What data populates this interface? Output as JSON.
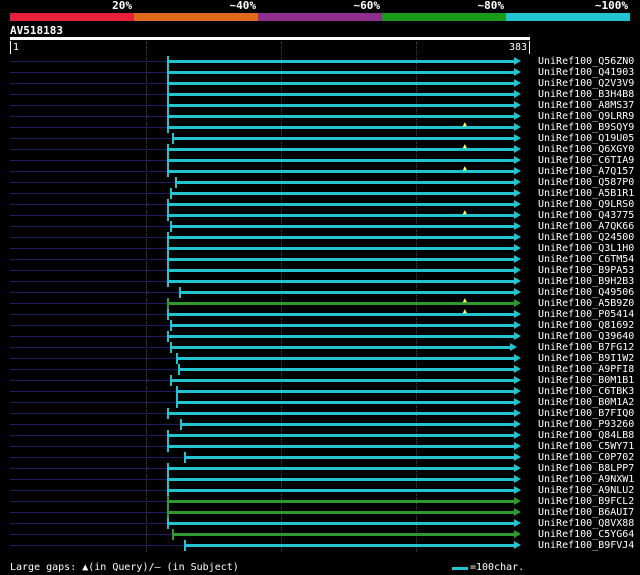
{
  "legend": {
    "items": [
      {
        "label": "20%",
        "color": "#e8203a"
      },
      {
        "label": "~40%",
        "color": "#e06a1a"
      },
      {
        "label": "~60%",
        "color": "#8e2f8e"
      },
      {
        "label": "~80%",
        "color": "#1a9a1a"
      },
      {
        "label": "~100%",
        "color": "#22c4cf"
      }
    ]
  },
  "query": {
    "title": "AV518183",
    "start": "1",
    "end": "383"
  },
  "colors": {
    "cyan": "#22c4cf",
    "green": "#2e9a2e",
    "gap": "#1a1f66",
    "caret": "#ffff66"
  },
  "hits": [
    {
      "label": "UniRef100_Q56ZN0",
      "start": 118,
      "end": 383,
      "color": "cyan",
      "caret": false
    },
    {
      "label": "UniRef100_Q41903",
      "start": 118,
      "end": 383,
      "color": "cyan",
      "caret": false
    },
    {
      "label": "UniRef100_Q2V3V9",
      "start": 118,
      "end": 383,
      "color": "cyan",
      "caret": false
    },
    {
      "label": "UniRef100_B3H4B8",
      "start": 118,
      "end": 383,
      "color": "cyan",
      "caret": false
    },
    {
      "label": "UniRef100_A8MS37",
      "start": 118,
      "end": 383,
      "color": "cyan",
      "caret": false
    },
    {
      "label": "UniRef100_Q9LRR9",
      "start": 118,
      "end": 383,
      "color": "cyan",
      "caret": false
    },
    {
      "label": "UniRef100_B9SQY9",
      "start": 118,
      "end": 383,
      "color": "cyan",
      "caret": true
    },
    {
      "label": "UniRef100_Q19U05",
      "start": 122,
      "end": 383,
      "color": "cyan",
      "caret": false
    },
    {
      "label": "UniRef100_Q6XGY0",
      "start": 118,
      "end": 383,
      "color": "cyan",
      "caret": true
    },
    {
      "label": "UniRef100_C6TIA9",
      "start": 118,
      "end": 383,
      "color": "cyan",
      "caret": false
    },
    {
      "label": "UniRef100_A7Q157",
      "start": 118,
      "end": 383,
      "color": "cyan",
      "caret": true
    },
    {
      "label": "UniRef100_Q587P0",
      "start": 124,
      "end": 383,
      "color": "cyan",
      "caret": false
    },
    {
      "label": "UniRef100_A5B1R1",
      "start": 120,
      "end": 383,
      "color": "cyan",
      "caret": false
    },
    {
      "label": "UniRef100_Q9LRS0",
      "start": 118,
      "end": 383,
      "color": "cyan",
      "caret": false
    },
    {
      "label": "UniRef100_Q43775",
      "start": 118,
      "end": 383,
      "color": "cyan",
      "caret": true
    },
    {
      "label": "UniRef100_A7QK66",
      "start": 120,
      "end": 383,
      "color": "cyan",
      "caret": false
    },
    {
      "label": "UniRef100_Q24500",
      "start": 118,
      "end": 383,
      "color": "cyan",
      "caret": false
    },
    {
      "label": "UniRef100_Q3L1H0",
      "start": 118,
      "end": 383,
      "color": "cyan",
      "caret": false
    },
    {
      "label": "UniRef100_C6TM54",
      "start": 118,
      "end": 383,
      "color": "cyan",
      "caret": false
    },
    {
      "label": "UniRef100_B9PA53",
      "start": 118,
      "end": 383,
      "color": "cyan",
      "caret": false
    },
    {
      "label": "UniRef100_B9H2B3",
      "start": 118,
      "end": 383,
      "color": "cyan",
      "caret": false
    },
    {
      "label": "UniRef100_Q49506",
      "start": 127,
      "end": 383,
      "color": "cyan",
      "caret": false
    },
    {
      "label": "UniRef100_A5B9Z0",
      "start": 118,
      "end": 383,
      "color": "green",
      "caret": true
    },
    {
      "label": "UniRef100_P05414",
      "start": 118,
      "end": 383,
      "color": "cyan",
      "caret": true
    },
    {
      "label": "UniRef100_Q81692",
      "start": 120,
      "end": 383,
      "color": "cyan",
      "caret": false
    },
    {
      "label": "UniRef100_Q39640",
      "start": 118,
      "end": 383,
      "color": "cyan",
      "caret": false
    },
    {
      "label": "UniRef100_B7FG12",
      "start": 120,
      "end": 380,
      "color": "cyan",
      "caret": false
    },
    {
      "label": "UniRef100_B9I1W2",
      "start": 125,
      "end": 383,
      "color": "cyan",
      "caret": false
    },
    {
      "label": "UniRef100_A9PFI8",
      "start": 126,
      "end": 383,
      "color": "cyan",
      "caret": false
    },
    {
      "label": "UniRef100_B0M1B1",
      "start": 120,
      "end": 383,
      "color": "cyan",
      "caret": false
    },
    {
      "label": "UniRef100_C6TBK3",
      "start": 125,
      "end": 383,
      "color": "cyan",
      "caret": false
    },
    {
      "label": "UniRef100_B0M1A2",
      "start": 125,
      "end": 383,
      "color": "cyan",
      "caret": false
    },
    {
      "label": "UniRef100_B7FIQ0",
      "start": 118,
      "end": 383,
      "color": "cyan",
      "caret": false
    },
    {
      "label": "UniRef100_P93260",
      "start": 128,
      "end": 383,
      "color": "cyan",
      "caret": false
    },
    {
      "label": "UniRef100_Q84LB8",
      "start": 118,
      "end": 383,
      "color": "cyan",
      "caret": false
    },
    {
      "label": "UniRef100_C5WY71",
      "start": 118,
      "end": 383,
      "color": "cyan",
      "caret": false
    },
    {
      "label": "UniRef100_C0P702",
      "start": 131,
      "end": 383,
      "color": "cyan",
      "caret": false
    },
    {
      "label": "UniRef100_B8LPP7",
      "start": 118,
      "end": 383,
      "color": "cyan",
      "caret": false
    },
    {
      "label": "UniRef100_A9NXW1",
      "start": 118,
      "end": 383,
      "color": "cyan",
      "caret": false
    },
    {
      "label": "UniRef100_A9NLU2",
      "start": 118,
      "end": 383,
      "color": "cyan",
      "caret": false
    },
    {
      "label": "UniRef100_B9FCL2",
      "start": 118,
      "end": 383,
      "color": "green",
      "caret": false
    },
    {
      "label": "UniRef100_B6AUI7",
      "start": 118,
      "end": 383,
      "color": "green",
      "caret": false
    },
    {
      "label": "UniRef100_Q8VX88",
      "start": 118,
      "end": 383,
      "color": "cyan",
      "caret": false
    },
    {
      "label": "UniRef100_C5YG64",
      "start": 122,
      "end": 383,
      "color": "green",
      "caret": false
    },
    {
      "label": "UniRef100_B9FVJ4",
      "start": 131,
      "end": 383,
      "color": "cyan",
      "caret": false
    }
  ],
  "footer": {
    "gaps_text": "Large gaps: ▲(in Query)/– (in Subject)",
    "scale_text": "=100char."
  }
}
